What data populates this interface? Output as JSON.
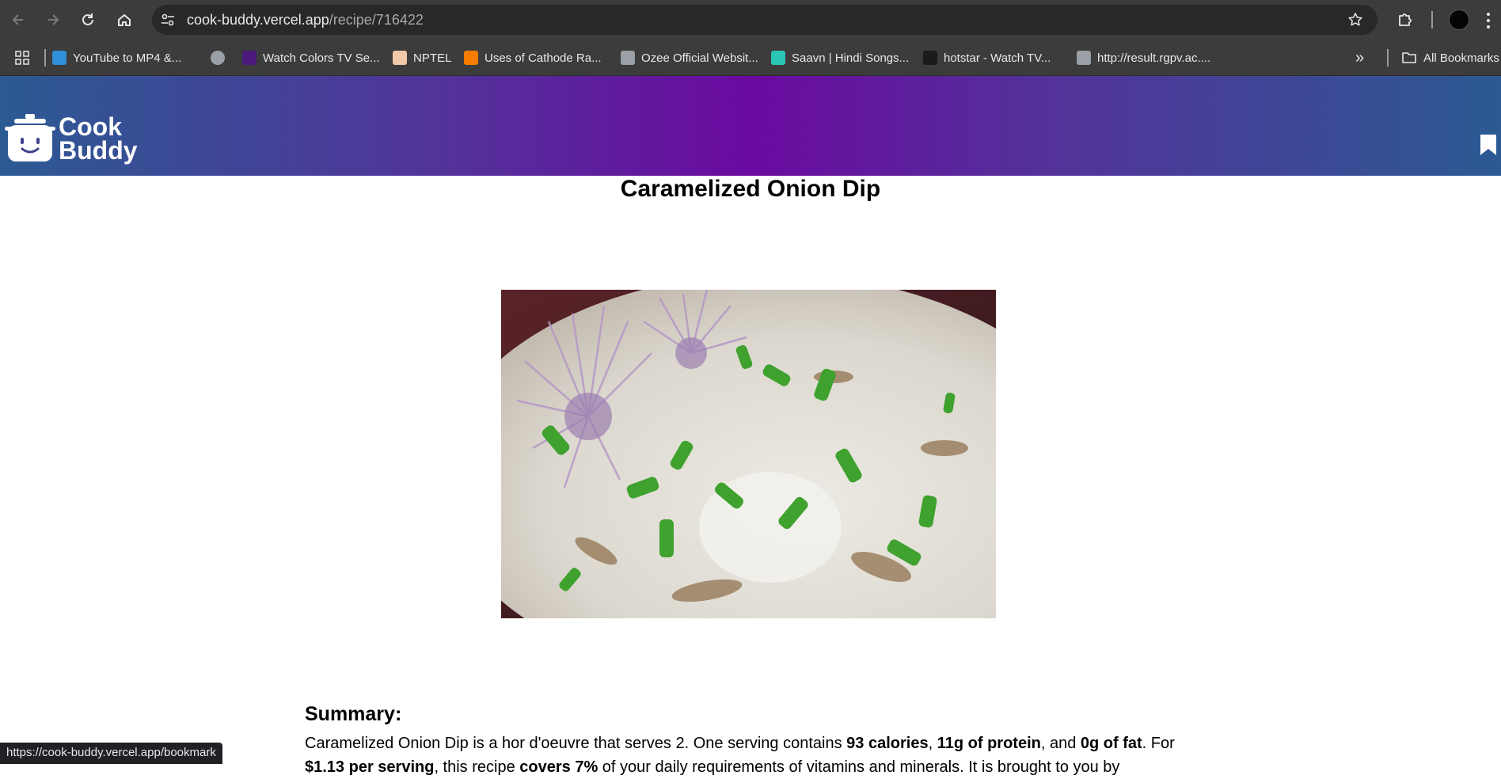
{
  "browser": {
    "url_host": "cook-buddy.vercel.app",
    "url_path": "/recipe/716422",
    "icons": {
      "back": "back-arrow-icon",
      "forward": "forward-arrow-icon",
      "reload": "reload-icon",
      "home": "home-icon",
      "site_info": "tune-icon",
      "star": "star-icon",
      "extensions": "puzzle-icon",
      "menu": "kebab-menu-icon"
    },
    "bookmarks": [
      {
        "label": "YouTube to MP4 &...",
        "color": "#2f8fd8"
      },
      {
        "label": "",
        "color": "#9aa0a6"
      },
      {
        "label": "Watch Colors TV Se...",
        "color": "#4b1a7a"
      },
      {
        "label": "NPTEL",
        "color": "#f2c9a8"
      },
      {
        "label": "Uses of Cathode Ra...",
        "color": "#f57c00"
      },
      {
        "label": "Ozee Official Websit...",
        "color": "#9aa0a6"
      },
      {
        "label": "Saavn | Hindi Songs...",
        "color": "#2bc5b4"
      },
      {
        "label": "hotstar - Watch TV...",
        "color": "#1b1b1b"
      },
      {
        "label": "http://result.rgpv.ac....",
        "color": "#9aa0a6"
      }
    ],
    "more_label": "»",
    "all_bookmarks_label": "All Bookmarks",
    "status_url": "https://cook-buddy.vercel.app/bookmark"
  },
  "site": {
    "logo_line1": "Cook",
    "logo_line2": "Buddy",
    "gradient_colors": [
      "#2c5a93",
      "#6a0aa0",
      "#2c5a93"
    ]
  },
  "recipe": {
    "title": "Caramelized Onion Dip",
    "summary_heading": "Summary:",
    "summary_parts": [
      {
        "text": "Caramelized Onion Dip is a hor d'oeuvre that serves 2. One serving contains ",
        "bold": false
      },
      {
        "text": "93 calories",
        "bold": true
      },
      {
        "text": ", ",
        "bold": false
      },
      {
        "text": "11g of protein",
        "bold": true
      },
      {
        "text": ", and ",
        "bold": false
      },
      {
        "text": "0g of fat",
        "bold": true
      },
      {
        "text": ". For ",
        "bold": false
      },
      {
        "text": "$1.13 per serving",
        "bold": true
      },
      {
        "text": ", this recipe ",
        "bold": false
      },
      {
        "text": "covers 7%",
        "bold": true
      },
      {
        "text": " of your daily requirements of vitamins and minerals. It is brought to you by",
        "bold": false
      }
    ]
  }
}
